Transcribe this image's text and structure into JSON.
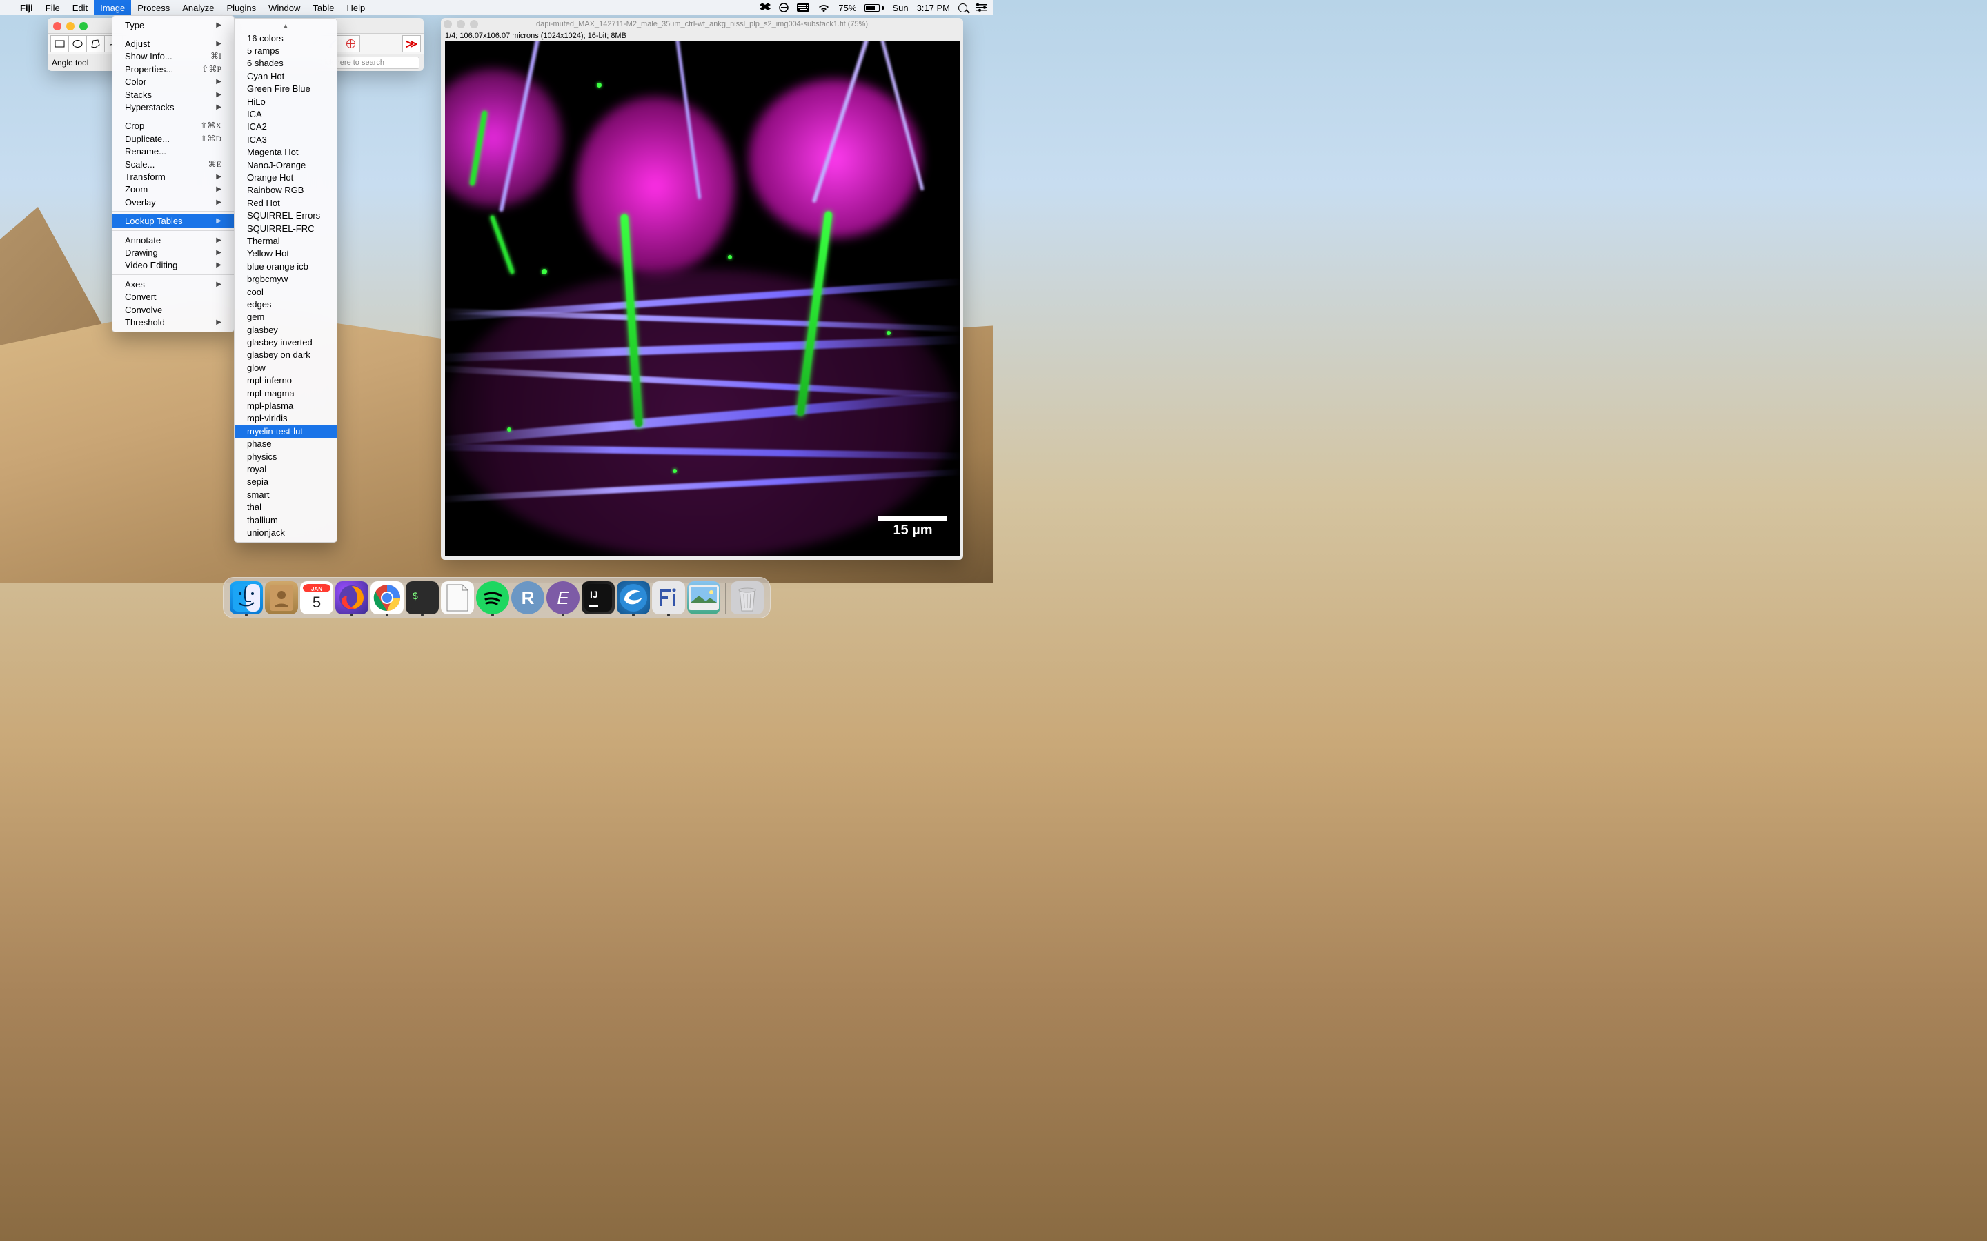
{
  "menubar": {
    "app_name": "Fiji",
    "items": [
      "File",
      "Edit",
      "Image",
      "Process",
      "Analyze",
      "Plugins",
      "Window",
      "Table",
      "Help"
    ],
    "selected": "Image",
    "status": {
      "battery": "75%",
      "day": "Sun",
      "time": "3:17 PM"
    }
  },
  "fiji_window": {
    "status_text": "Angle tool",
    "search_placeholder": "Click here to search"
  },
  "image_menu": {
    "items": [
      {
        "label": "Type",
        "arrow": true
      },
      "-",
      {
        "label": "Adjust",
        "arrow": true
      },
      {
        "label": "Show Info...",
        "sc": "⌘I"
      },
      {
        "label": "Properties...",
        "sc": "⇧⌘P"
      },
      {
        "label": "Color",
        "arrow": true
      },
      {
        "label": "Stacks",
        "arrow": true
      },
      {
        "label": "Hyperstacks",
        "arrow": true
      },
      "-",
      {
        "label": "Crop",
        "sc": "⇧⌘X"
      },
      {
        "label": "Duplicate...",
        "sc": "⇧⌘D"
      },
      {
        "label": "Rename..."
      },
      {
        "label": "Scale...",
        "sc": "⌘E"
      },
      {
        "label": "Transform",
        "arrow": true
      },
      {
        "label": "Zoom",
        "arrow": true
      },
      {
        "label": "Overlay",
        "arrow": true
      },
      "-",
      {
        "label": "Lookup Tables",
        "arrow": true,
        "selected": true
      },
      "-",
      {
        "label": "Annotate",
        "arrow": true
      },
      {
        "label": "Drawing",
        "arrow": true
      },
      {
        "label": "Video Editing",
        "arrow": true
      },
      "-",
      {
        "label": "Axes",
        "arrow": true
      },
      {
        "label": "Convert"
      },
      {
        "label": "Convolve"
      },
      {
        "label": "Threshold",
        "arrow": true
      }
    ]
  },
  "lut_menu": {
    "items": [
      "16 colors",
      "5 ramps",
      "6 shades",
      "Cyan Hot",
      "Green Fire Blue",
      "HiLo",
      "ICA",
      "ICA2",
      "ICA3",
      "Magenta Hot",
      "NanoJ-Orange",
      "Orange Hot",
      "Rainbow RGB",
      "Red Hot",
      "SQUIRREL-Errors",
      "SQUIRREL-FRC",
      "Thermal",
      "Yellow Hot",
      "blue orange icb",
      "brgbcmyw",
      "cool",
      "edges",
      "gem",
      "glasbey",
      "glasbey inverted",
      "glasbey on dark",
      "glow",
      "mpl-inferno",
      "mpl-magma",
      "mpl-plasma",
      "mpl-viridis",
      "myelin-test-lut",
      "phase",
      "physics",
      "royal",
      "sepia",
      "smart",
      "thal",
      "thallium",
      "unionjack"
    ],
    "selected": "myelin-test-lut"
  },
  "image_window": {
    "title": "dapi-muted_MAX_142711-M2_male_35um_ctrl-wt_ankg_nissl_plp_s2_img004-substack1.tif (75%)",
    "info": "1/4; 106.07x106.07 microns (1024x1024); 16-bit; 8MB",
    "scale_label": "15 µm"
  },
  "calendar": {
    "month": "JAN",
    "day": "5"
  },
  "dock": {
    "items": [
      "finder",
      "contacts",
      "calendar",
      "firefox",
      "chrome",
      "terminal",
      "libreoffice",
      "spotify",
      "rstudio",
      "emacs",
      "intellij",
      "thunderbird",
      "fiji",
      "preview"
    ],
    "running": [
      "finder",
      "firefox",
      "chrome",
      "terminal",
      "spotify",
      "emacs",
      "thunderbird",
      "fiji"
    ]
  }
}
